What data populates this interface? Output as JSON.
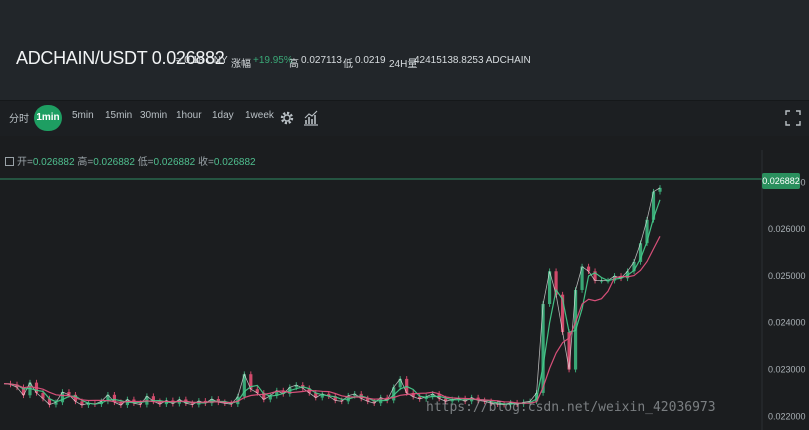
{
  "ticker": {
    "pair": "ADCHAIN/USDT 0.026882",
    "cny": "≈ 0.18 CNY",
    "change_label": "涨幅",
    "change_value": "+19.95%",
    "high_label": "高",
    "high_value": "0.027113",
    "low_label": "低",
    "low_value": "0.0219",
    "volume_label": "24H量",
    "volume_value": "42415138.8253 ADCHAIN"
  },
  "toolbar": {
    "intervals": [
      "分时",
      "1min",
      "5min",
      "15min",
      "30min",
      "1hour",
      "1day",
      "1week"
    ],
    "active_interval": "1min",
    "icons": [
      "gear-icon",
      "indicator-icon",
      "fullscreen-icon"
    ]
  },
  "ohlc": {
    "icon": "square-icon",
    "open_label": "开=",
    "open_value": "0.026882",
    "high_label": "高=",
    "high_value": "0.026882",
    "low_label": "低=",
    "low_value": "0.026882",
    "close_label": "收=",
    "close_value": "0.026882"
  },
  "price_axis": {
    "current": "0.026882",
    "ticks": [
      "0.027000",
      "0.026000",
      "0.025000",
      "0.024000",
      "0.023000",
      "0.022000"
    ]
  },
  "colors": {
    "up": "#3aa776",
    "down": "#d14a6b",
    "ma_pink": "#e0527d",
    "ma_white": "#e8e8e8",
    "ma_green": "#46c98a",
    "active": "#1e9e62"
  },
  "watermark": "https://blog.csdn.net/weixin_42036973",
  "chart_data": {
    "type": "line",
    "ylim": [
      0.0219,
      0.0272
    ],
    "series": [
      {
        "values": [
          0.0227,
          0.02268,
          0.02262,
          0.02245,
          0.02272,
          0.0225,
          0.02238,
          0.02225,
          0.0223,
          0.02252,
          0.02246,
          0.02232,
          0.02224,
          0.02228,
          0.02226,
          0.02232,
          0.02246,
          0.0223,
          0.02224,
          0.02236,
          0.02228,
          0.02225,
          0.02243,
          0.02232,
          0.02226,
          0.02234,
          0.02227,
          0.02236,
          0.02228,
          0.02225,
          0.02233,
          0.02228,
          0.02237,
          0.0223,
          0.02228,
          0.02226,
          0.02242,
          0.0229,
          0.02258,
          0.0225,
          0.02236,
          0.02244,
          0.02255,
          0.02248,
          0.02262,
          0.02267,
          0.0226,
          0.0225,
          0.0224,
          0.02248,
          0.02243,
          0.02234,
          0.02232,
          0.02244,
          0.02248,
          0.02238,
          0.02232,
          0.02228,
          0.0224,
          0.02234,
          0.02262,
          0.0228,
          0.0225,
          0.02242,
          0.02237,
          0.02242,
          0.02248,
          0.02238,
          0.02232,
          0.02236,
          0.02238,
          0.02232,
          0.0224,
          0.02234,
          0.02232,
          0.02228,
          0.02226,
          0.02225,
          0.02229,
          0.02226,
          0.0223,
          0.02232,
          0.0225,
          0.0244,
          0.0251,
          0.0246,
          0.0238,
          0.023,
          0.0247,
          0.0252,
          0.0251,
          0.0249,
          0.0249,
          0.0249,
          0.025,
          0.02495,
          0.0251,
          0.0253,
          0.0257,
          0.0262,
          0.0268,
          0.026882
        ]
      }
    ]
  }
}
